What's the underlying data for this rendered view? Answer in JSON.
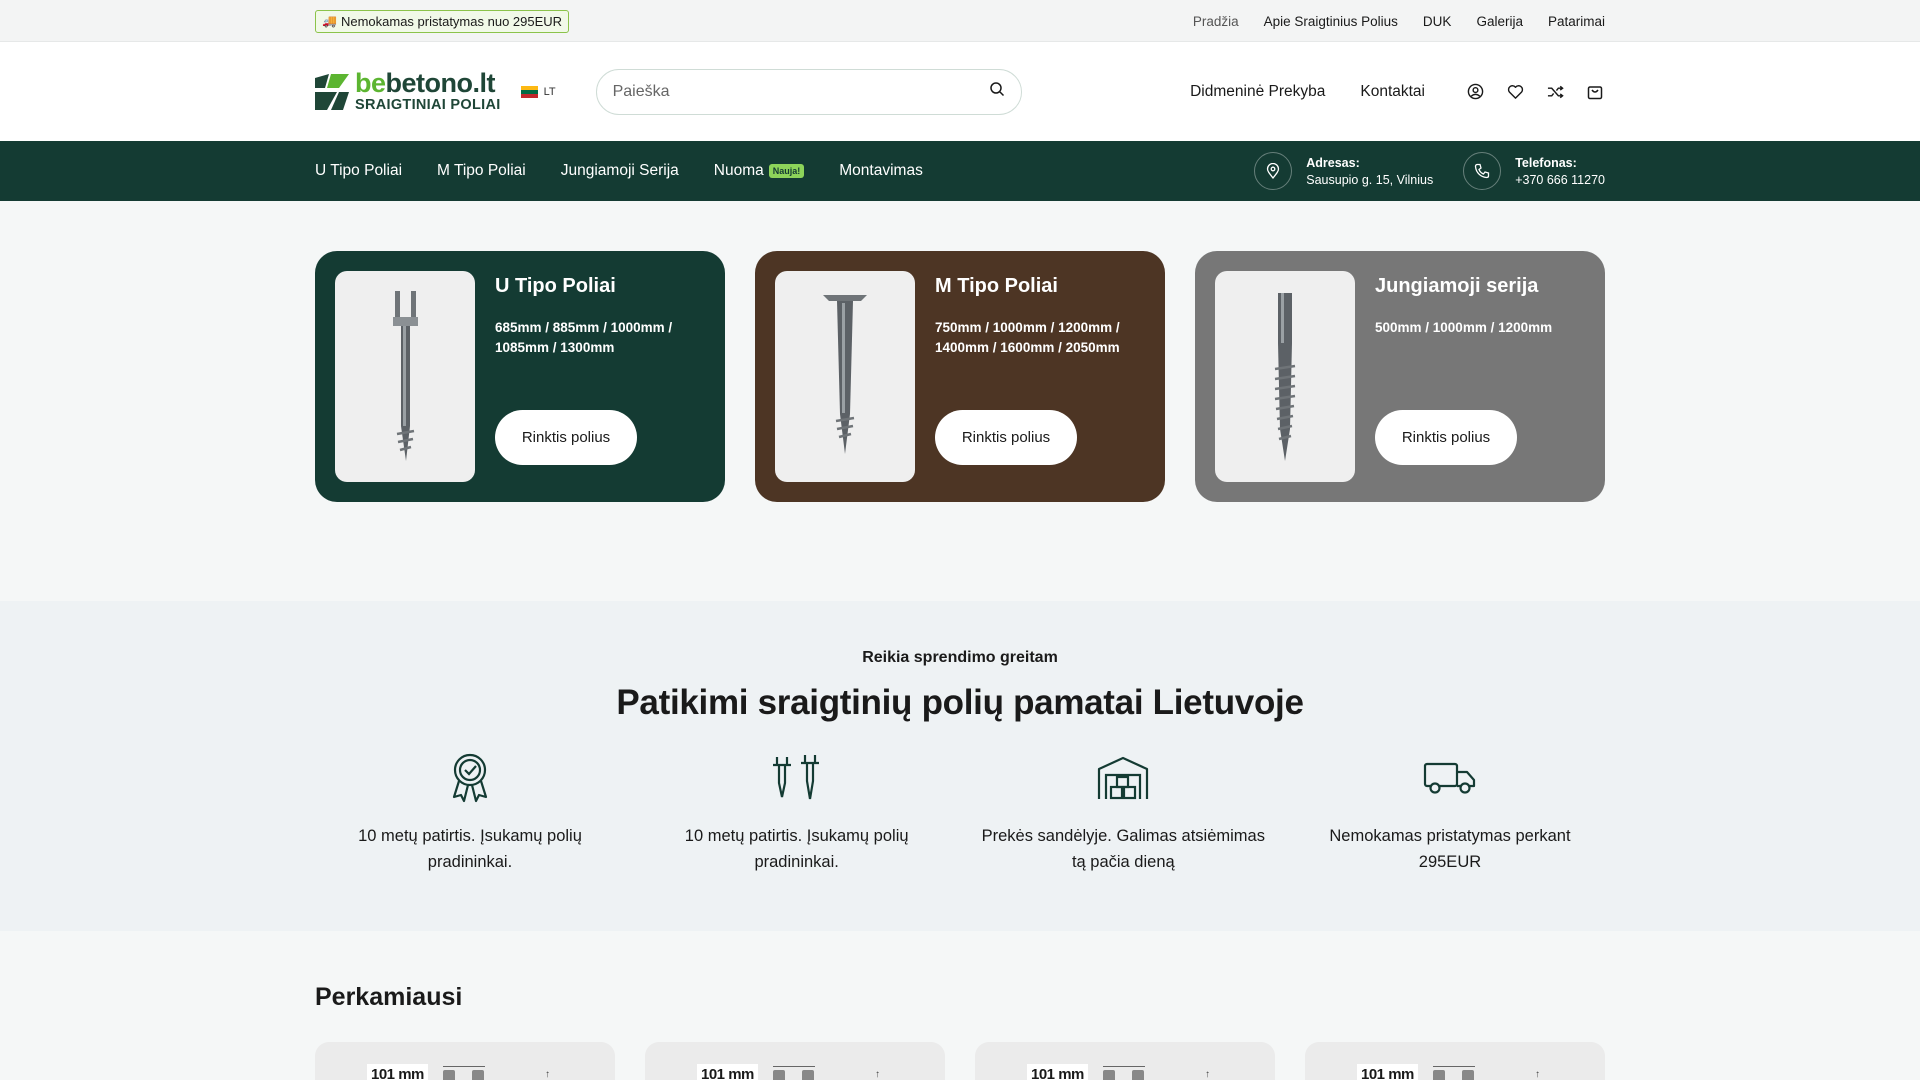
{
  "topbar": {
    "promo": "Nemokamas pristatymas nuo 295EUR",
    "links": [
      "Pradžia",
      "Apie Sraigtinius Polius",
      "DUK",
      "Galerija",
      "Patarimai"
    ]
  },
  "header": {
    "logo_prefix": "be",
    "logo_rest": "betono.lt",
    "logo_sub": "SRAIGTINIAI POLIAI",
    "lang": "LT",
    "search_placeholder": "Paieška",
    "links": [
      "Didmeninė Prekyba",
      "Kontaktai"
    ],
    "icons": [
      "user-icon",
      "heart-icon",
      "shuffle-icon",
      "cart-icon"
    ]
  },
  "mainnav": {
    "links": [
      "U Tipo Poliai",
      "M Tipo Poliai",
      "Jungiamoji Serija",
      "Nuoma",
      "Montavimas"
    ],
    "new_badge": "Nauja!",
    "address_label": "Adresas:",
    "address_value": "Sausupio g. 15, Vilnius",
    "phone_label": "Telefonas:",
    "phone_value": "+370 666 11270"
  },
  "cards": [
    {
      "title": "U Tipo Poliai",
      "sizes": "685mm / 885mm / 1000mm / 1085mm / 1300mm",
      "button": "Rinktis polius",
      "color": "#143b33"
    },
    {
      "title": "M Tipo Poliai",
      "sizes": "750mm / 1000mm / 1200mm / 1400mm / 1600mm / 2050mm",
      "button": "Rinktis polius",
      "color": "#4d3524"
    },
    {
      "title": "Jungiamoji serija",
      "sizes": "500mm / 1000mm / 1200mm",
      "button": "Rinktis polius",
      "color": "#777777"
    }
  ],
  "features": {
    "kicker": "Reikia sprendimo greitam",
    "title": "Patikimi sraigtinių polių pamatai Lietuvoje",
    "items": [
      {
        "icon": "award-icon",
        "text": "10 metų patirtis. Įsukamų polių pradininkai."
      },
      {
        "icon": "pile-icon",
        "text": "10 metų patirtis. Įsukamų polių pradininkai."
      },
      {
        "icon": "warehouse-icon",
        "text": "Prekės sandėlyje. Galimas atsiėmimas tą pačia dieną"
      },
      {
        "icon": "truck-icon",
        "text": "Nemokamas pristatymas perkant 295EUR"
      }
    ]
  },
  "bestsellers": {
    "title": "Perkamiausi",
    "products": [
      {
        "dimension": "101 mm"
      },
      {
        "dimension": "101 mm"
      },
      {
        "dimension": "101 mm"
      },
      {
        "dimension": "101 mm"
      }
    ]
  }
}
